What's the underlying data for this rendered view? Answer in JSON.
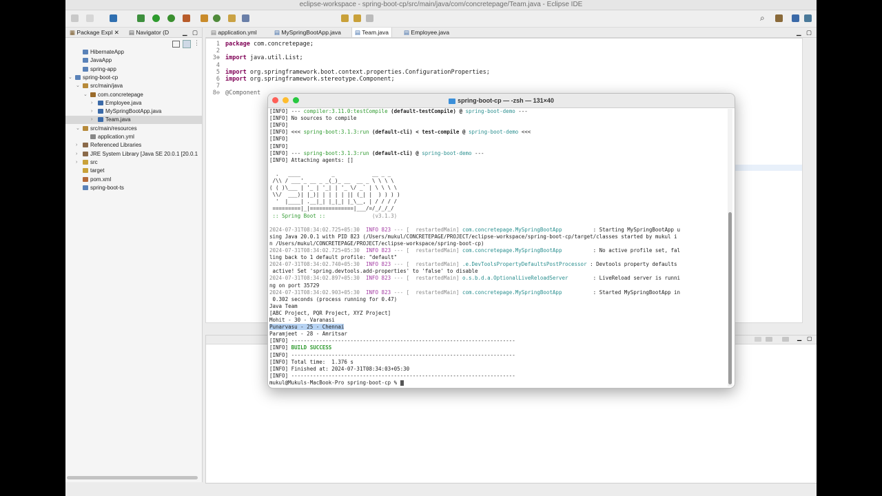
{
  "window": {
    "title": "eclipse-workspace - spring-boot-cp/src/main/java/com/concretepage/Team.java - Eclipse IDE"
  },
  "left_panel": {
    "tabs": [
      "Package Expl",
      "Navigator (D"
    ],
    "tree": [
      {
        "label": "HibernateApp",
        "indent": 1,
        "twisty": "",
        "icon": "project-icon"
      },
      {
        "label": "JavaApp",
        "indent": 1,
        "twisty": "",
        "icon": "project-icon"
      },
      {
        "label": "spring-app",
        "indent": 1,
        "twisty": "",
        "icon": "project-icon"
      },
      {
        "label": "spring-boot-cp",
        "indent": 0,
        "twisty": "⌄",
        "icon": "project-icon"
      },
      {
        "label": "src/main/java",
        "indent": 1,
        "twisty": "⌄",
        "icon": "source-folder-icon"
      },
      {
        "label": "com.concretepage",
        "indent": 2,
        "twisty": "⌄",
        "icon": "package-icon"
      },
      {
        "label": "Employee.java",
        "indent": 3,
        "twisty": "›",
        "icon": "java-file-icon"
      },
      {
        "label": "MySpringBootApp.java",
        "indent": 3,
        "twisty": "›",
        "icon": "java-file-icon"
      },
      {
        "label": "Team.java",
        "indent": 3,
        "twisty": "›",
        "icon": "java-file-icon",
        "selected": true
      },
      {
        "label": "src/main/resources",
        "indent": 1,
        "twisty": "⌄",
        "icon": "source-folder-icon"
      },
      {
        "label": "application.yml",
        "indent": 2,
        "twisty": "",
        "icon": "yml-file-icon"
      },
      {
        "label": "Referenced Libraries",
        "indent": 1,
        "twisty": "›",
        "icon": "library-icon"
      },
      {
        "label": "JRE System Library [Java SE 20.0.1 [20.0.1",
        "indent": 1,
        "twisty": "›",
        "icon": "library-icon"
      },
      {
        "label": "src",
        "indent": 1,
        "twisty": "›",
        "icon": "folder-icon"
      },
      {
        "label": "target",
        "indent": 1,
        "twisty": "",
        "icon": "folder-icon"
      },
      {
        "label": "pom.xml",
        "indent": 1,
        "twisty": "",
        "icon": "xml-file-icon"
      },
      {
        "label": "spring-boot-ts",
        "indent": 1,
        "twisty": "",
        "icon": "project-icon"
      }
    ]
  },
  "editor": {
    "tabs": [
      {
        "label": "application.yml",
        "active": false
      },
      {
        "label": "MySpringBootApp.java",
        "active": false
      },
      {
        "label": "Team.java",
        "active": true
      },
      {
        "label": "Employee.java",
        "active": false
      }
    ],
    "lines": [
      {
        "num": "1",
        "kw": "package",
        "rest": " com.concretepage;"
      },
      {
        "num": "2",
        "kw": "",
        "rest": ""
      },
      {
        "num": "3⊕",
        "kw": "import",
        "rest": " java.util.List;"
      },
      {
        "num": "4",
        "kw": "",
        "rest": ""
      },
      {
        "num": "5",
        "kw": "import",
        "rest": " org.springframework.boot.context.properties.ConfigurationProperties;"
      },
      {
        "num": "6",
        "kw": "import",
        "rest": " org.springframework.stereotype.Component;"
      },
      {
        "num": "7",
        "kw": "",
        "rest": ""
      },
      {
        "num": "8⊖",
        "kw": "",
        "rest": "@Component"
      }
    ]
  },
  "terminal": {
    "title": "spring-boot-cp — -zsh — 131×40",
    "lines": [
      [
        {
          "t": "[INFO] --- "
        },
        {
          "t": "compiler:3.11.0:testCompile",
          "c": "c-green"
        },
        {
          "t": " (default-testCompile) @ ",
          "c": "b"
        },
        {
          "t": "spring-boot-demo",
          "c": "c-teal"
        },
        {
          "t": " ---"
        }
      ],
      [
        {
          "t": "[INFO] No sources to compile"
        }
      ],
      [
        {
          "t": "[INFO]"
        }
      ],
      [
        {
          "t": "[INFO] <<< "
        },
        {
          "t": "spring-boot:3.1.3:run",
          "c": "c-green"
        },
        {
          "t": " (default-cli) < test-compile @ ",
          "c": "b"
        },
        {
          "t": "spring-boot-demo",
          "c": "c-teal"
        },
        {
          "t": " <<<"
        }
      ],
      [
        {
          "t": "[INFO]"
        }
      ],
      [
        {
          "t": "[INFO]"
        }
      ],
      [
        {
          "t": "[INFO] --- "
        },
        {
          "t": "spring-boot:3.1.3:run",
          "c": "c-green"
        },
        {
          "t": " (default-cli) @ ",
          "c": "b"
        },
        {
          "t": "spring-boot-demo",
          "c": "c-teal"
        },
        {
          "t": " ---"
        }
      ],
      [
        {
          "t": "[INFO] Attaching agents: []"
        }
      ],
      [
        {
          "t": ""
        }
      ],
      [
        {
          "t": "  .   ____          _            __ _ _"
        }
      ],
      [
        {
          "t": " /\\\\ / ___'_ __ _ _(_)_ __  __ _ \\ \\ \\ \\"
        }
      ],
      [
        {
          "t": "( ( )\\___ | '_ | '_| | '_ \\/ _` | \\ \\ \\ \\"
        }
      ],
      [
        {
          "t": " \\\\/  ___)| |_)| | | | | || (_| |  ) ) ) )"
        }
      ],
      [
        {
          "t": "  '  |____| .__|_| |_|_| |_\\__, | / / / /"
        }
      ],
      [
        {
          "t": " =========|_|==============|___/=/_/_/_/"
        }
      ],
      [
        {
          "t": " :: Spring Boot :: ",
          "c": "c-green"
        },
        {
          "t": "              (v3.1.3)",
          "c": "c-gray"
        }
      ],
      [
        {
          "t": ""
        }
      ],
      [
        {
          "t": "2024-07-31T08:34:02.725+05:30  ",
          "c": "c-gray"
        },
        {
          "t": "INFO 823",
          "c": "c-purple"
        },
        {
          "t": " --- [  restartedMain] ",
          "c": "c-gray"
        },
        {
          "t": "com.concretepage.MySpringBootApp        ",
          "c": "c-teal"
        },
        {
          "t": "  : Starting MySpringBootApp u"
        }
      ],
      [
        {
          "t": "sing Java 20.0.1 with PID 823 (/Users/mukul/CONCRETEPAGE/PROJECT/eclipse-workspace/spring-boot-cp/target/classes started by mukul i"
        }
      ],
      [
        {
          "t": "n /Users/mukul/CONCRETEPAGE/PROJECT/eclipse-workspace/spring-boot-cp)"
        }
      ],
      [
        {
          "t": "2024-07-31T08:34:02.725+05:30  ",
          "c": "c-gray"
        },
        {
          "t": "INFO 823",
          "c": "c-purple"
        },
        {
          "t": " --- [  restartedMain] ",
          "c": "c-gray"
        },
        {
          "t": "com.concretepage.MySpringBootApp        ",
          "c": "c-teal"
        },
        {
          "t": "  : No active profile set, fal"
        }
      ],
      [
        {
          "t": "ling back to 1 default profile: \"default\""
        }
      ],
      [
        {
          "t": "2024-07-31T08:34:02.740+05:30  ",
          "c": "c-gray"
        },
        {
          "t": "INFO 823",
          "c": "c-purple"
        },
        {
          "t": " --- [  restartedMain] ",
          "c": "c-gray"
        },
        {
          "t": ".e.DevToolsPropertyDefaultsPostProcessor",
          "c": "c-teal"
        },
        {
          "t": " : Devtools property defaults"
        }
      ],
      [
        {
          "t": " active! Set 'spring.devtools.add-properties' to 'false' to disable"
        }
      ],
      [
        {
          "t": "2024-07-31T08:34:02.897+05:30  ",
          "c": "c-gray"
        },
        {
          "t": "INFO 823",
          "c": "c-purple"
        },
        {
          "t": " --- [  restartedMain] ",
          "c": "c-gray"
        },
        {
          "t": "o.s.b.d.a.OptionalLiveReloadServer      ",
          "c": "c-teal"
        },
        {
          "t": "  : LiveReload server is runni"
        }
      ],
      [
        {
          "t": "ng on port 35729"
        }
      ],
      [
        {
          "t": "2024-07-31T08:34:02.903+05:30  ",
          "c": "c-gray"
        },
        {
          "t": "INFO 823",
          "c": "c-purple"
        },
        {
          "t": " --- [  restartedMain] ",
          "c": "c-gray"
        },
        {
          "t": "com.concretepage.MySpringBootApp        ",
          "c": "c-teal"
        },
        {
          "t": "  : Started MySpringBootApp in"
        }
      ],
      [
        {
          "t": " 0.302 seconds (process running for 0.47)"
        }
      ],
      [
        {
          "t": "Java Team"
        }
      ],
      [
        {
          "t": "[ABC Project, PQR Project, XYZ Project]"
        }
      ],
      [
        {
          "t": "Mohit - 30 - Varanasi"
        }
      ],
      [
        {
          "t": "Punarvasu - 25 - Chennai",
          "c": "sel-text"
        }
      ],
      [
        {
          "t": "Paramjeet - 28 - Amritsar"
        }
      ],
      [
        {
          "t": "[INFO] ------------------------------------------------------------------------"
        }
      ],
      [
        {
          "t": "[INFO] "
        },
        {
          "t": "BUILD SUCCESS",
          "c": "c-green b"
        }
      ],
      [
        {
          "t": "[INFO] ------------------------------------------------------------------------"
        }
      ],
      [
        {
          "t": "[INFO] Total time:  1.376 s"
        }
      ],
      [
        {
          "t": "[INFO] Finished at: 2024-07-31T08:34:03+05:30"
        }
      ],
      [
        {
          "t": "[INFO] ------------------------------------------------------------------------"
        }
      ],
      [
        {
          "t": "mukul@Mukuls-MacBook-Pro spring-boot-cp % "
        }
      ]
    ]
  },
  "colors": {
    "close": "#ff5f57",
    "minimize": "#febc2e",
    "zoom": "#28c840",
    "folder": "#3b8fd9"
  }
}
